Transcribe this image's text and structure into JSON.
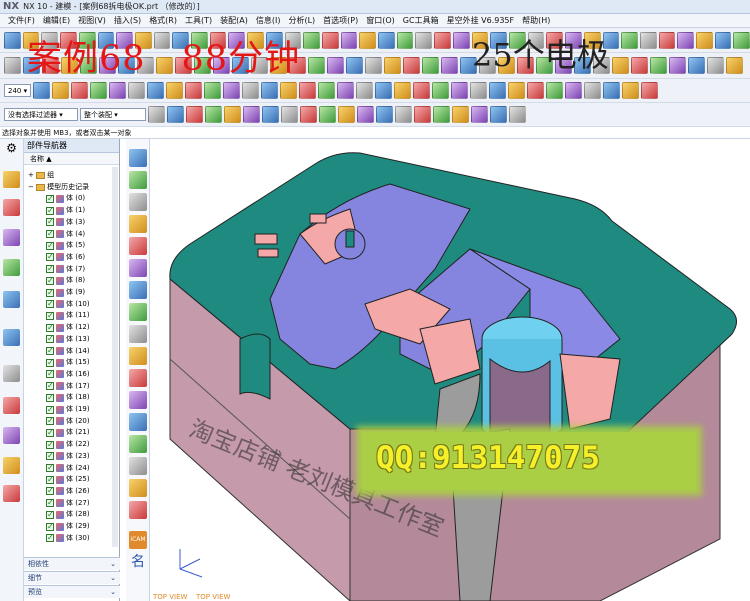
{
  "app": {
    "logo": "NX",
    "title": "NX 10 - 建模 - [案例68拆电极OK.prt （修改的）]"
  },
  "menu": [
    "文件(F)",
    "编辑(E)",
    "视图(V)",
    "插入(S)",
    "格式(R)",
    "工具(T)",
    "装配(A)",
    "信息(I)",
    "分析(L)",
    "首选项(P)",
    "窗口(O)",
    "GC工具箱",
    "星空外挂 V6.935F",
    "帮助(H)"
  ],
  "toolbar": {
    "zoom_value": "240",
    "selection_filter": "没有选择过滤器",
    "assembly_scope": "整个装配"
  },
  "status_text": "选择对象并使用 MB3，或者双击某一对象",
  "navigator": {
    "title": "部件导航器",
    "col_name": "名称",
    "group_label": "组",
    "history_label": "模型历史记录",
    "body_label": "体",
    "bodies": [
      "(0)",
      "(1)",
      "(3)",
      "(4)",
      "(5)",
      "(6)",
      "(7)",
      "(8)",
      "(9)",
      "(10)",
      "(11)",
      "(12)",
      "(13)",
      "(14)",
      "(15)",
      "(16)",
      "(17)",
      "(18)",
      "(19)",
      "(20)",
      "(21)",
      "(22)",
      "(23)",
      "(24)",
      "(25)",
      "(26)",
      "(27)",
      "(28)",
      "(29)",
      "(30)"
    ],
    "footer": [
      "相依性",
      "细节",
      "预览"
    ]
  },
  "overlay": {
    "case_text": "案例68　88分钟",
    "electrode_text": "25个电极",
    "qq_text": "QQ:913147075",
    "shop_text": "淘宝店铺 老刘模具工作室",
    "view_label": "TOP VIEW"
  },
  "view_tools": {
    "icam_label": "iCAM",
    "name_label": "名"
  },
  "colors": {
    "teal_top": "#1f8a7f",
    "side_pink": "#c9a6b3",
    "purple": "#8686e0",
    "pink": "#f2a6a6",
    "cyan": "#6fd0f0",
    "gray": "#9c9c9c",
    "overlay_red": "#e41616",
    "qq_bg": "#aacf45"
  }
}
